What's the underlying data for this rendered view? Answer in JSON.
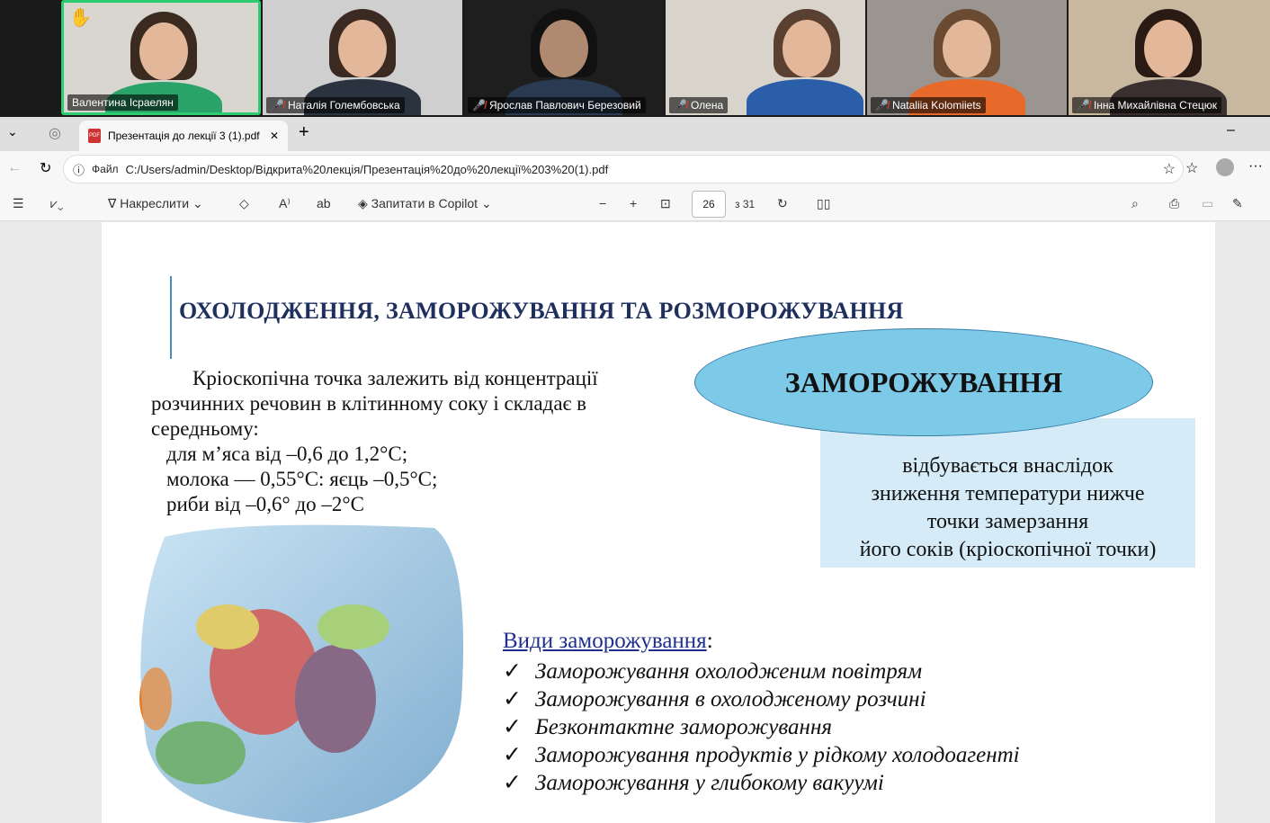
{
  "participants": [
    {
      "name": "Валентина Ісраелян",
      "muted": false,
      "hand_raised": true,
      "active": true
    },
    {
      "name": "Наталія Голембовська",
      "muted": true
    },
    {
      "name": "Ярослав Павлович Березовий",
      "muted": true
    },
    {
      "name": "Олена",
      "muted": true
    },
    {
      "name": "Nataliia Kolomiiets",
      "muted": true
    },
    {
      "name": "Інна Михайлівна Стецюк",
      "muted": true
    }
  ],
  "browser": {
    "tab_title": "Презентація до лекції 3 (1).pdf",
    "url_label": "Файл",
    "url": "C:/Users/admin/Desktop/Відкрита%20лекція/Презентація%20до%20лекції%203%20(1).pdf"
  },
  "pdf_toolbar": {
    "draw_label": "Накреслити",
    "copilot_label": "Запитати в Copilot",
    "page_current": "26",
    "page_total": "з 31"
  },
  "slide": {
    "title": "ОХОЛОДЖЕННЯ, ЗАМОРОЖУВАННЯ ТА РОЗМОРОЖУВАННЯ",
    "para_lines": [
      "Кріоскопічна точка залежить від концентрації",
      "розчинних речовин в клітинному соку і складає в",
      "середньому:",
      "для м’яса від –0,6 до 1,2°С;",
      "молока — 0,55°С: яєць –0,5°С;",
      "риби від –0,6° до –2°С"
    ],
    "ellipse": "ЗАМОРОЖУВАННЯ",
    "box_lines": [
      "відбувається внаслідок",
      "зниження температури нижче",
      "точки замерзання",
      "його соків (кріоскопічної точки)"
    ],
    "kinds_heading": "Види заморожування",
    "check": "✓",
    "kinds": [
      "Заморожування охолодженим повітрям",
      "Заморожування в охолодженому розчині",
      "Безконтактне заморожування",
      "Заморожування продуктів у рідкому холодоагенті",
      "Заморожування у глибокому вакуумі"
    ]
  }
}
